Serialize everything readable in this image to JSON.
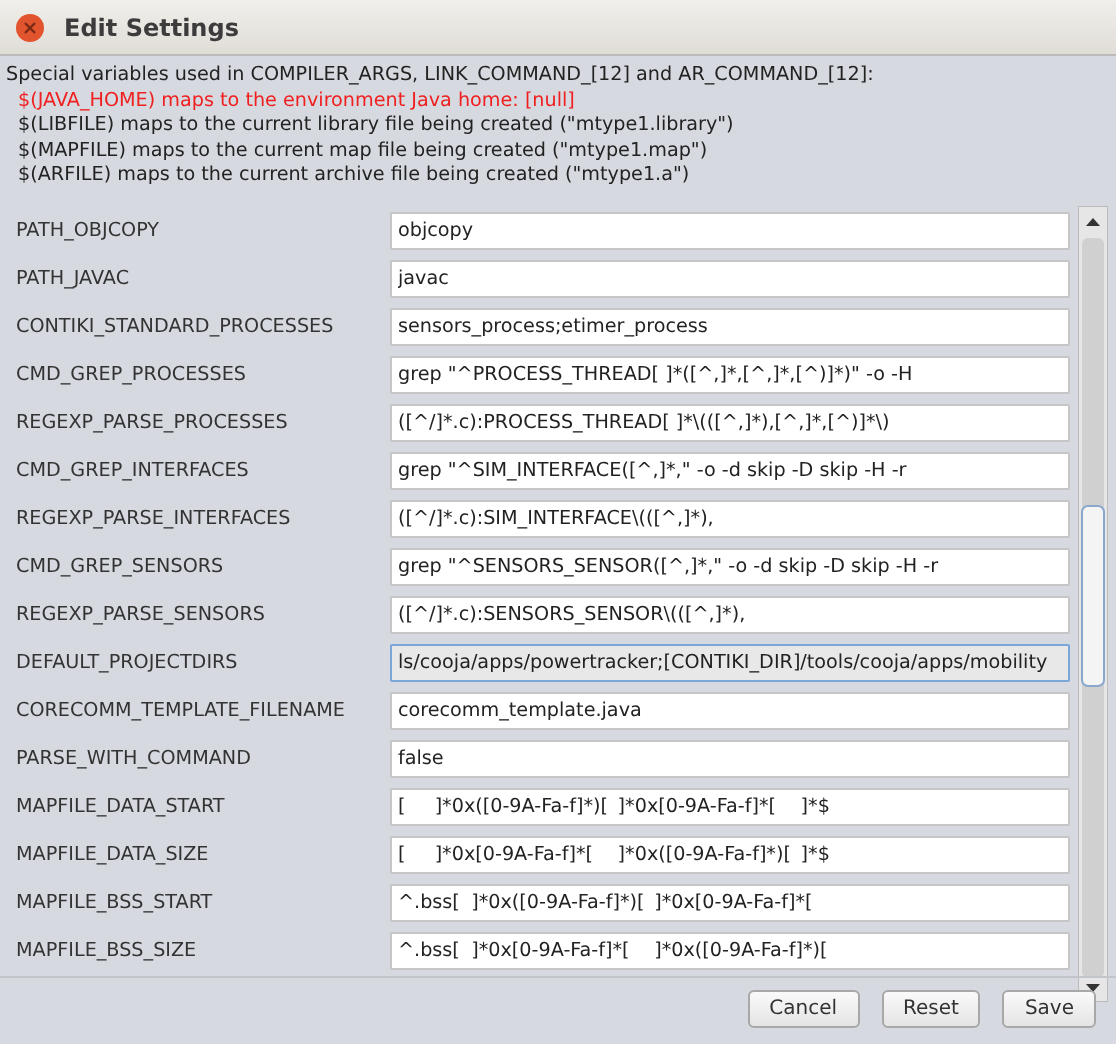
{
  "window": {
    "title": "Edit Settings"
  },
  "info": {
    "heading": "Special variables used in COMPILER_ARGS, LINK_COMMAND_[12] and AR_COMMAND_[12]:",
    "lines": [
      {
        "text": "$(JAVA_HOME) maps to the environment Java home: [null]",
        "warning": true
      },
      {
        "text": "$(LIBFILE) maps to the current library file being created (\"mtype1.library\")",
        "warning": false
      },
      {
        "text": "$(MAPFILE) maps to the current map file being created (\"mtype1.map\")",
        "warning": false
      },
      {
        "text": "$(ARFILE) maps to the current archive file being created (\"mtype1.a\")",
        "warning": false
      }
    ]
  },
  "settings": [
    {
      "name": "PATH_OBJCOPY",
      "value": "objcopy",
      "focused": false
    },
    {
      "name": "PATH_JAVAC",
      "value": "javac",
      "focused": false
    },
    {
      "name": "CONTIKI_STANDARD_PROCESSES",
      "value": "sensors_process;etimer_process",
      "focused": false
    },
    {
      "name": "CMD_GREP_PROCESSES",
      "value": "grep \"^PROCESS_THREAD[ ]*([^,]*,[^,]*,[^)]*)\" -o -H",
      "focused": false
    },
    {
      "name": "REGEXP_PARSE_PROCESSES",
      "value": "([^/]*.c):PROCESS_THREAD[ ]*\\(([^,]*),[^,]*,[^)]*\\)",
      "focused": false
    },
    {
      "name": "CMD_GREP_INTERFACES",
      "value": "grep \"^SIM_INTERFACE([^,]*,\" -o -d skip -D skip -H -r",
      "focused": false
    },
    {
      "name": "REGEXP_PARSE_INTERFACES",
      "value": "([^/]*.c):SIM_INTERFACE\\(([^,]*),",
      "focused": false
    },
    {
      "name": "CMD_GREP_SENSORS",
      "value": "grep \"^SENSORS_SENSOR([^,]*,\" -o -d skip -D skip -H -r",
      "focused": false
    },
    {
      "name": "REGEXP_PARSE_SENSORS",
      "value": "([^/]*.c):SENSORS_SENSOR\\(([^,]*),",
      "focused": false
    },
    {
      "name": "DEFAULT_PROJECTDIRS",
      "value": "ls/cooja/apps/powertracker;[CONTIKI_DIR]/tools/cooja/apps/mobility",
      "focused": true
    },
    {
      "name": "CORECOMM_TEMPLATE_FILENAME",
      "value": "corecomm_template.java",
      "focused": false
    },
    {
      "name": "PARSE_WITH_COMMAND",
      "value": "false",
      "focused": false
    },
    {
      "name": "MAPFILE_DATA_START",
      "value": "[\t]*0x([0-9A-Fa-f]*)[\t]*0x[0-9A-Fa-f]*[\t]*$",
      "focused": false
    },
    {
      "name": "MAPFILE_DATA_SIZE",
      "value": "[\t]*0x[0-9A-Fa-f]*[\t]*0x([0-9A-Fa-f]*)[\t]*$",
      "focused": false
    },
    {
      "name": "MAPFILE_BSS_START",
      "value": "^.bss[\t]*0x([0-9A-Fa-f]*)[\t]*0x[0-9A-Fa-f]*[",
      "focused": false
    },
    {
      "name": "MAPFILE_BSS_SIZE",
      "value": "^.bss[\t]*0x[0-9A-Fa-f]*[\t]*0x([0-9A-Fa-f]*)[",
      "focused": false
    }
  ],
  "buttons": [
    "Cancel",
    "Reset",
    "Save"
  ]
}
